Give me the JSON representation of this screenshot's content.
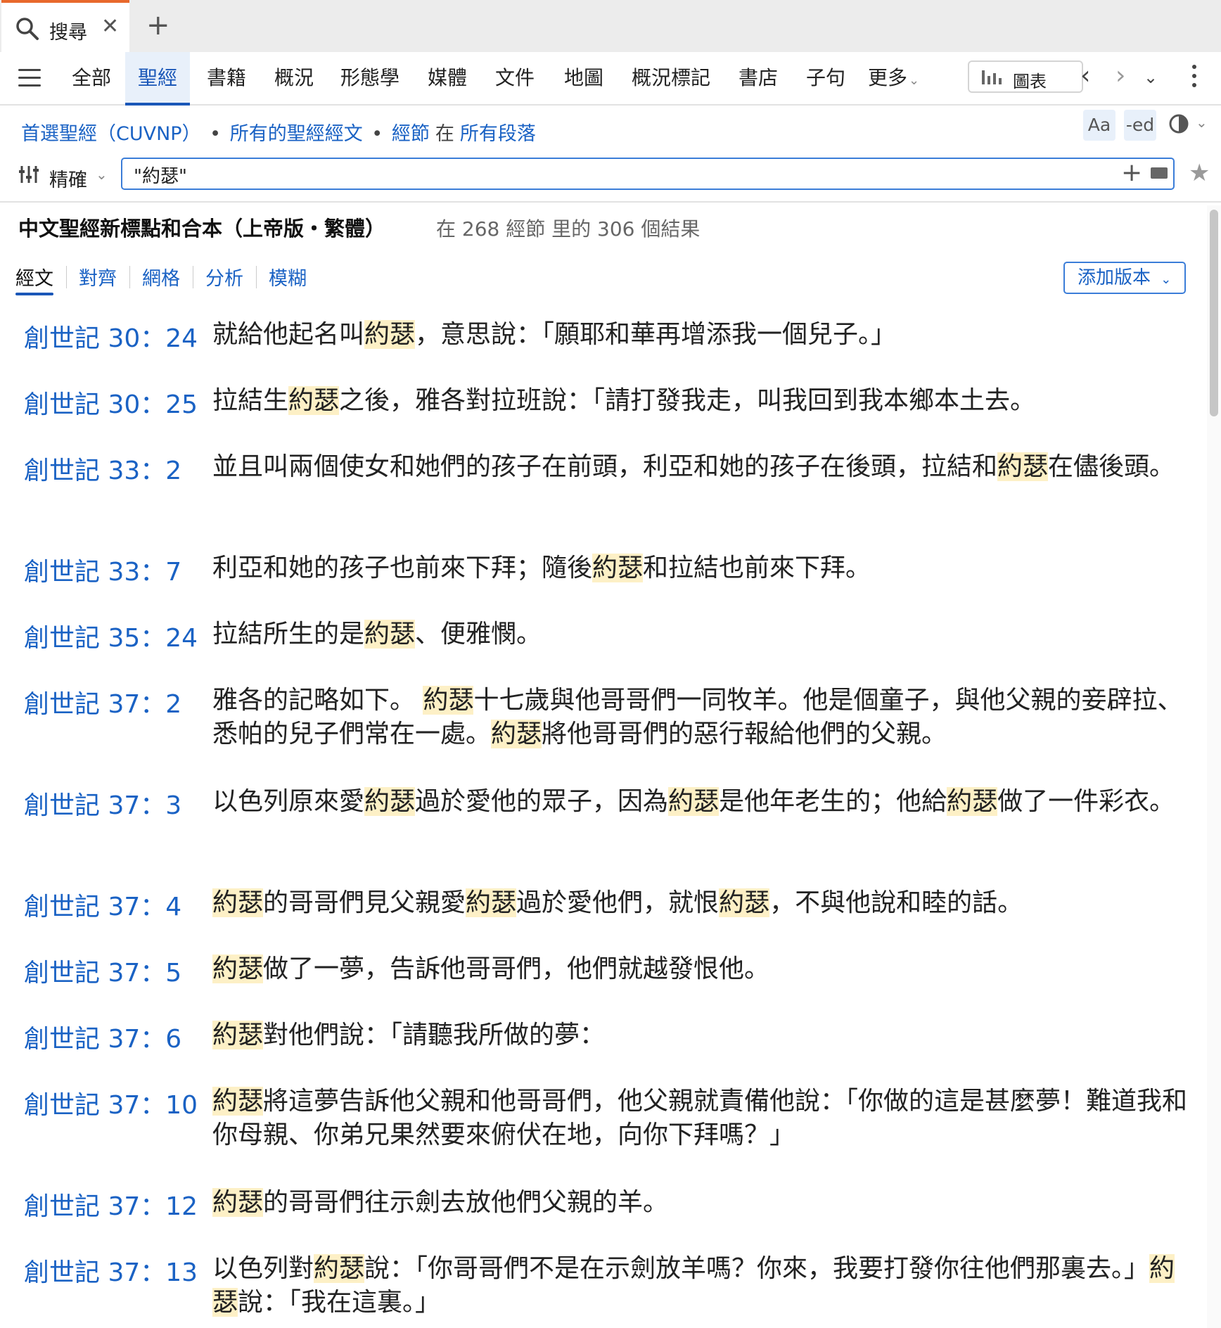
{
  "tab": {
    "title": "搜尋",
    "close": "✕",
    "new_tab": "+"
  },
  "nav": {
    "items": [
      "全部",
      "聖經",
      "書籍",
      "概況",
      "形態學",
      "媒體",
      "文件",
      "地圖",
      "概況標記",
      "書店",
      "子句",
      "更多"
    ],
    "active": "聖經",
    "more_chevron": "⌄",
    "chart_button": "圖表",
    "back": "‹",
    "forward": "›",
    "history_chevron": "⌄"
  },
  "scope": {
    "bible": "首選聖經（CUVNP）",
    "sep1": "•",
    "range": "所有的聖經經文",
    "sep2": "•",
    "unit": "經節",
    "in": "在",
    "where": "所有段落"
  },
  "tools": {
    "font_size": "Aa",
    "inflection": "-ed"
  },
  "search": {
    "mode": "精確",
    "query": "\"約瑟\"",
    "add": "+",
    "favorite": "★"
  },
  "results": {
    "version_title": "中文聖經新標點和合本（上帝版・繁體）",
    "summary": "在 268 經節 里的 306 個結果",
    "subtabs": [
      "經文",
      "對齊",
      "網格",
      "分析",
      "模糊"
    ],
    "active_subtab": "經文",
    "add_version": "添加版本"
  },
  "highlight_term": "約瑟",
  "verses": [
    {
      "ref": "創世記 30：24",
      "text": "就給他起名叫約瑟，意思說：「願耶和華再增添我一個兒子。」"
    },
    {
      "ref": "創世記 30：25",
      "text": "拉結生約瑟之後，雅各對拉班說：「請打發我走，叫我回到我本鄉本土去。"
    },
    {
      "ref": "創世記 33：2",
      "text": "並且叫兩個使女和她們的孩子在前頭，利亞和她的孩子在後頭，拉結和約瑟在儘後頭。"
    },
    {
      "ref": "創世記 33：7",
      "text": "利亞和她的孩子也前來下拜；隨後約瑟和拉結也前來下拜。"
    },
    {
      "ref": "創世記 35：24",
      "text": "拉結所生的是約瑟、便雅憫。"
    },
    {
      "ref": "創世記 37：2",
      "text": "雅各的記略如下。 約瑟十七歲與他哥哥們一同牧羊。他是個童子，與他父親的妾辟拉、悉帕的兒子們常在一處。約瑟將他哥哥們的惡行報給他們的父親。"
    },
    {
      "ref": "創世記 37：3",
      "text": "以色列原來愛約瑟過於愛他的眾子，因為約瑟是他年老生的；他給約瑟做了一件彩衣。"
    },
    {
      "ref": "創世記 37：4",
      "text": "約瑟的哥哥們見父親愛約瑟過於愛他們，就恨約瑟，不與他說和睦的話。"
    },
    {
      "ref": "創世記 37：5",
      "text": "約瑟做了一夢，告訴他哥哥們，他們就越發恨他。"
    },
    {
      "ref": "創世記 37：6",
      "text": "約瑟對他們說：「請聽我所做的夢："
    },
    {
      "ref": "創世記 37：10",
      "text": "約瑟將這夢告訴他父親和他哥哥們，他父親就責備他說：「你做的這是甚麼夢！難道我和你母親、你弟兄果然要來俯伏在地，向你下拜嗎？」"
    },
    {
      "ref": "創世記 37：12",
      "text": "約瑟的哥哥們往示劍去放他們父親的羊。"
    },
    {
      "ref": "創世記 37：13",
      "text": "以色列對約瑟說：「你哥哥們不是在示劍放羊嗎？你來，我要打發你往他們那裏去。」約瑟說：「我在這裏。」"
    }
  ]
}
